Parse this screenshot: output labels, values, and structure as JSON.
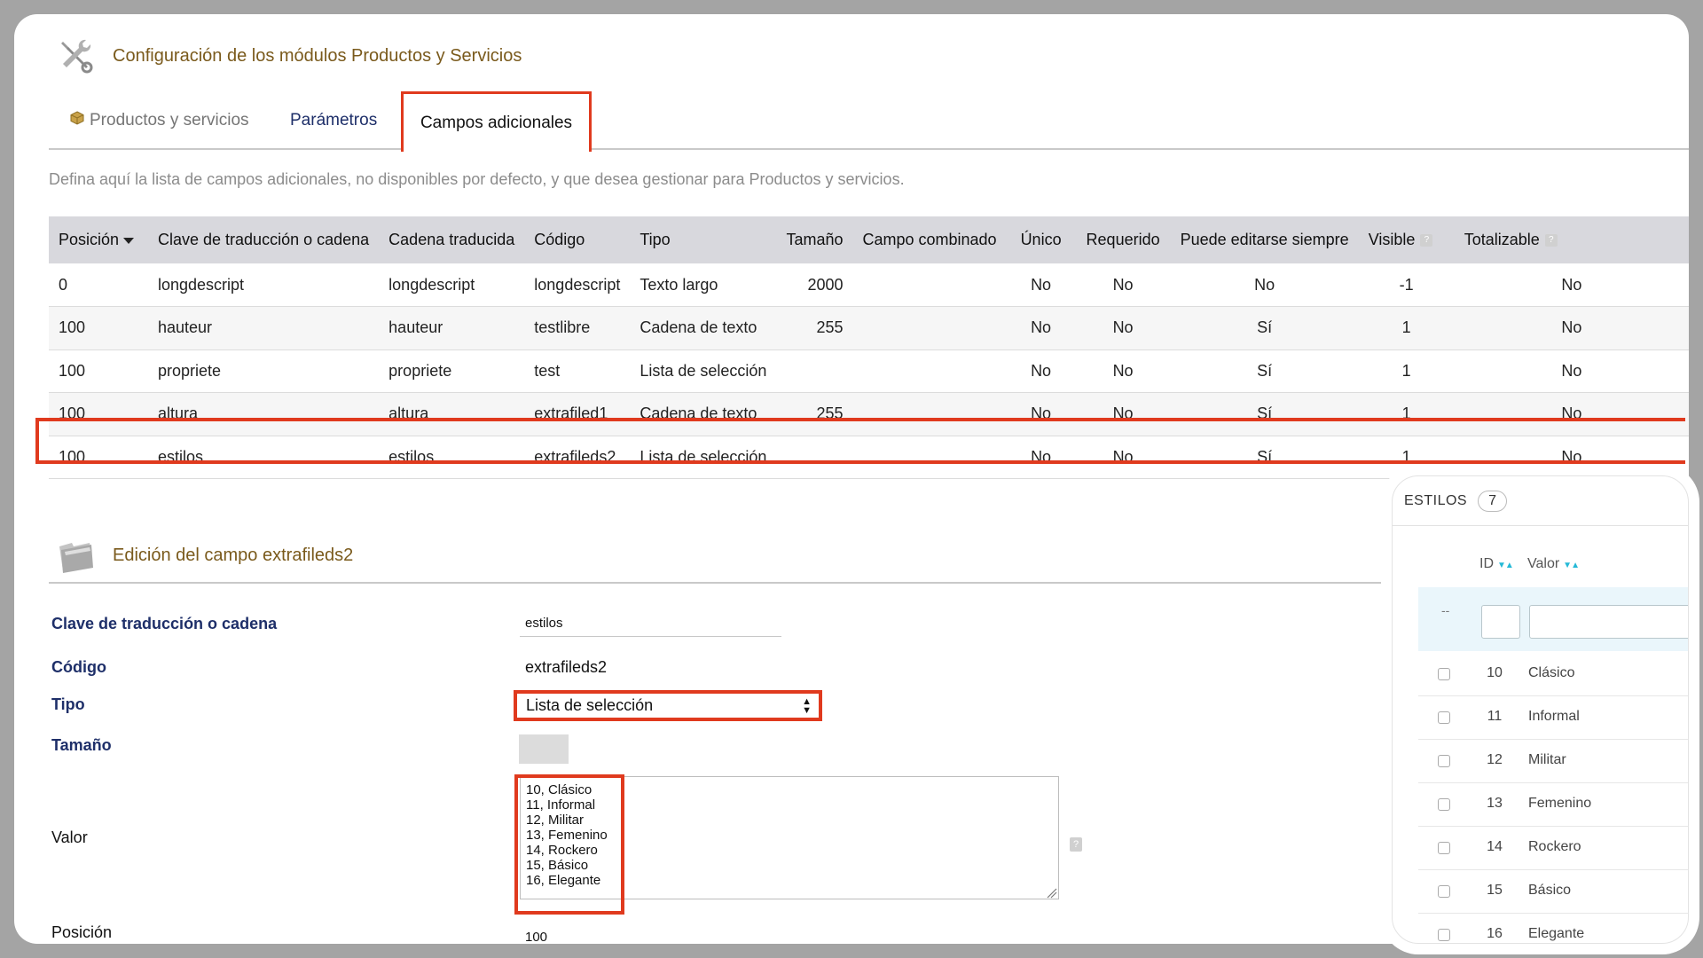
{
  "header": {
    "title": "Configuración de los módulos Productos y Servicios"
  },
  "tabs": [
    {
      "label": "Productos y servicios"
    },
    {
      "label": "Parámetros"
    },
    {
      "label": "Campos adicionales"
    }
  ],
  "description": "Defina aquí la lista de campos adicionales, no disponibles por defecto, y que desea gestionar para Productos y servicios.",
  "table": {
    "columns": [
      "Posición",
      "Clave de traducción o cadena",
      "Cadena traducida",
      "Código",
      "Tipo",
      "Tamaño",
      "Campo combinado",
      "Único",
      "Requerido",
      "Puede editarse siempre",
      "Visible",
      "Totalizable"
    ],
    "rows": [
      [
        "0",
        "longdescript",
        "longdescript",
        "longdescript",
        "Texto largo",
        "2000",
        "",
        "No",
        "No",
        "No",
        "-1",
        "No"
      ],
      [
        "100",
        "hauteur",
        "hauteur",
        "testlibre",
        "Cadena de texto",
        "255",
        "",
        "No",
        "No",
        "Sí",
        "1",
        "No"
      ],
      [
        "100",
        "propriete",
        "propriete",
        "test",
        "Lista de selección",
        "",
        "",
        "No",
        "No",
        "Sí",
        "1",
        "No"
      ],
      [
        "100",
        "altura",
        "altura",
        "extrafiled1",
        "Cadena de texto",
        "255",
        "",
        "No",
        "No",
        "Sí",
        "1",
        "No"
      ],
      [
        "100",
        "estilos",
        "estilos",
        "extrafileds2",
        "Lista de selección",
        "",
        "",
        "No",
        "No",
        "Sí",
        "1",
        "No"
      ]
    ]
  },
  "edit": {
    "title": "Edición del campo extrafileds2",
    "labels": {
      "key": "Clave de traducción o cadena",
      "code": "Código",
      "type": "Tipo",
      "size": "Tamaño",
      "value": "Valor",
      "position": "Posición"
    },
    "key_value": "estilos",
    "code_value": "extrafileds2",
    "type_value": "Lista de selección",
    "value_lines": [
      "10, Clásico",
      "11, Informal",
      "12, Militar",
      "13, Femenino",
      "14, Rockero",
      "15, Básico",
      "16, Elegante"
    ],
    "position_value": "100",
    "help_mark": "?"
  },
  "side_panel": {
    "title": "ESTILOS",
    "count": "7",
    "col_id": "ID",
    "col_value": "Valor",
    "filter_dash": "--",
    "rows": [
      {
        "id": "10",
        "value": "Clásico"
      },
      {
        "id": "11",
        "value": "Informal"
      },
      {
        "id": "12",
        "value": "Militar"
      },
      {
        "id": "13",
        "value": "Femenino"
      },
      {
        "id": "14",
        "value": "Rockero"
      },
      {
        "id": "15",
        "value": "Básico"
      },
      {
        "id": "16",
        "value": "Elegante"
      }
    ]
  },
  "colors": {
    "highlight": "#e03a1e",
    "title": "#7a5a1c",
    "link": "#1e2f69",
    "accent": "#25b9d7"
  },
  "icons": [
    "tools-icon",
    "package-icon",
    "folder-icon",
    "sort-down-icon",
    "help-icon",
    "checkbox-icon",
    "sort-arrows-icon",
    "resize-handle-icon"
  ]
}
